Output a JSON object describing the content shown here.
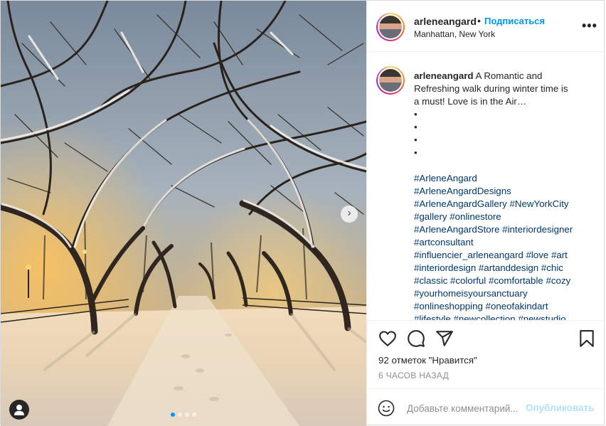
{
  "post": {
    "author": {
      "username": "arleneangard",
      "location": "Manhattan, New York",
      "follow_label": "Подписаться",
      "follow_separator": "•",
      "more_label": "•••"
    },
    "photo": {
      "carousel_dots": 4,
      "active_dot": 0,
      "next_icon": "chevron-right-icon",
      "next_label": "›",
      "tag_icon": "user-tag-icon"
    },
    "caption": {
      "lines": [
        "A Romantic and",
        "Refreshing walk during winter time is",
        "a must! Love is in the Air…",
        "•",
        "•",
        "•",
        "•"
      ],
      "hashtag_lines": [
        "#ArleneAngard",
        "#ArleneAngardDesigns",
        "#ArleneAngardGallery #NewYorkCity",
        "#gallery #onlinestore",
        "#ArleneAngardStore #interiordesigner",
        "#artconsultant",
        "#influencier_arleneangard #love #art",
        "#interiordesign #artanddesign #chic",
        "#classic #colorful #comfortable #cozy",
        "#yourhomeisyoursanctuary",
        "#onlineshopping #oneofakindart",
        "#lifestyle #newcollection #newstudio"
      ]
    },
    "actions": {
      "like_icon": "heart-icon",
      "comment_icon": "comment-icon",
      "share_icon": "paper-plane-icon",
      "save_icon": "bookmark-icon"
    },
    "likes_text": "92 отметок \"Нравится\"",
    "timestamp": "6 ЧАСОВ НАЗАД",
    "comment": {
      "placeholder": "Добавьте комментарий...",
      "value": "",
      "publish_label": "Опубликовать",
      "emoji_icon": "smiley-icon"
    },
    "colors": {
      "link_blue": "#0095f6",
      "hashtag": "#00376b",
      "muted": "#8e8e8e",
      "publish_disabled": "#b2dffc"
    }
  }
}
